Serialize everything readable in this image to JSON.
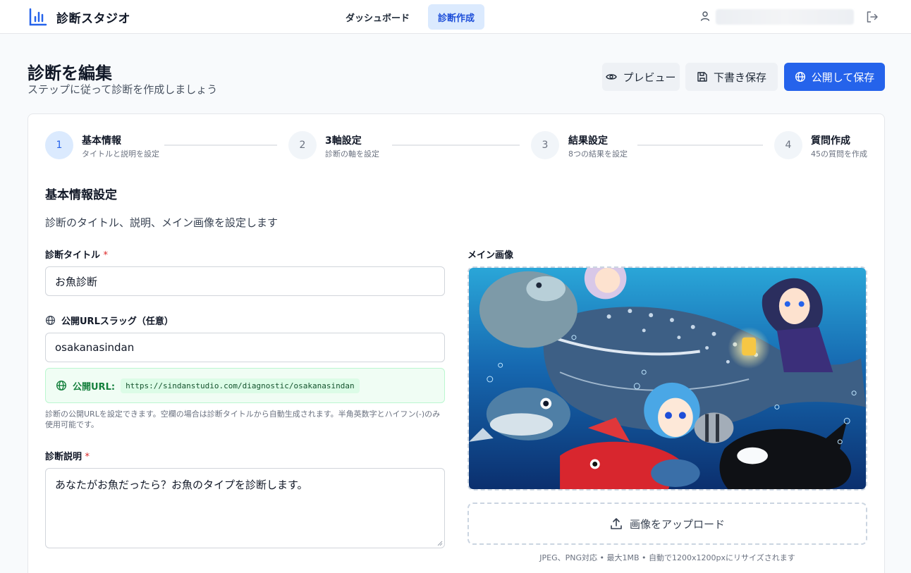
{
  "app": {
    "name": "診断スタジオ"
  },
  "nav": {
    "dashboard": "ダッシュボード",
    "create": "診断作成"
  },
  "header": {
    "title": "診断を編集",
    "subtitle": "ステップに従って診断を作成しましょう",
    "preview_label": "プレビュー",
    "draft_label": "下書き保存",
    "publish_label": "公開して保存"
  },
  "steps": [
    {
      "number": "1",
      "title": "基本情報",
      "desc": "タイトルと説明を設定"
    },
    {
      "number": "2",
      "title": "3軸設定",
      "desc": "診断の軸を設定"
    },
    {
      "number": "3",
      "title": "結果設定",
      "desc": "8つの結果を設定"
    },
    {
      "number": "4",
      "title": "質問作成",
      "desc": "45の質問を作成"
    }
  ],
  "section": {
    "title": "基本情報設定",
    "description": "診断のタイトル、説明、メイン画像を設定します"
  },
  "form": {
    "title_label": "診断タイトル",
    "required_mark": "*",
    "title_value": "お魚診断",
    "slug_label": "公開URLスラッグ（任意）",
    "slug_value": "osakanasindan",
    "public_url_label": "公開URL:",
    "public_url_value": "https://sindanstudio.com/diagnostic/osakanasindan",
    "slug_help": "診断の公開URLを設定できます。空欄の場合は診断タイトルから自動生成されます。半角英数字とハイフン(-)のみ使用可能です。",
    "description_label": "診断説明",
    "description_value": "あなたがお魚だったら？お魚のタイプを診断します。"
  },
  "image": {
    "label": "メイン画像",
    "upload_label": "画像をアップロード",
    "note": "JPEG、PNG対応 • 最大1MB • 自動で1200x1200pxにリサイズされます"
  },
  "colors": {
    "primary": "#2563eb",
    "active_bg": "#dbeafe",
    "success": "#15803d"
  }
}
